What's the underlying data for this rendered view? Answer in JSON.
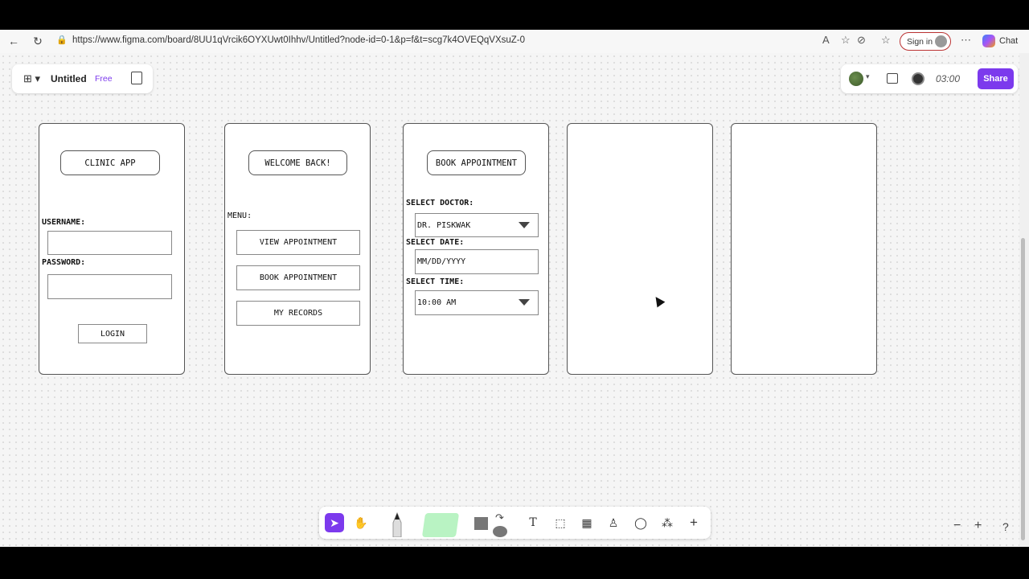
{
  "browser": {
    "url": "https://www.figma.com/board/8UU1qVrcik6OYXUwt0Ihhv/Untitled?node-id=0-1&p=f&t=scg7k4OVEQqVXsuZ-0",
    "sign_in": "Sign in",
    "chat": "Chat"
  },
  "figma": {
    "file_name": "Untitled",
    "plan": "Free",
    "timer": "03:00",
    "share": "Share"
  },
  "frames": {
    "login": {
      "title": "CLINIC APP",
      "username_label": "USERNAME:",
      "password_label": "PASSWORD:",
      "login_button": "LOGIN"
    },
    "menu": {
      "title": "WELCOME BACK!",
      "menu_label": "MENU:",
      "view": "VIEW APPOINTMENT",
      "book": "BOOK APPOINTMENT",
      "records": "MY RECORDS"
    },
    "booking": {
      "title": "BOOK APPOINTMENT",
      "doctor_label": "SELECT DOCTOR:",
      "doctor_value": "DR. PISKWAK",
      "date_label": "SELECT DATE:",
      "date_placeholder": "MM/DD/YYYY",
      "time_label": "SELECT TIME:",
      "time_value": "10:00 AM"
    }
  },
  "toolbar": {
    "text_tool": "T",
    "add": "+"
  },
  "zoom": {
    "out": "−",
    "in": "+",
    "help": "?"
  },
  "colors": {
    "accent": "#7c3aed",
    "sticky": "#b9f3c3"
  }
}
